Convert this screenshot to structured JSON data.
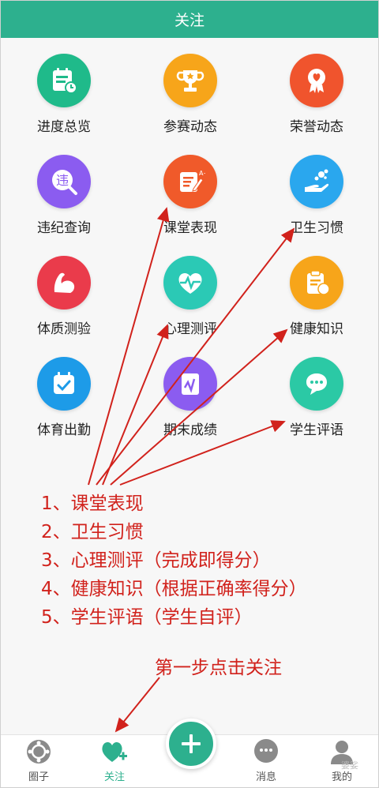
{
  "header": {
    "title": "关注"
  },
  "grid": [
    {
      "label": "进度总览",
      "icon": "calendar-clock-icon",
      "color": "#1fba8a"
    },
    {
      "label": "参赛动态",
      "icon": "trophy-icon",
      "color": "#f7a51a"
    },
    {
      "label": "荣誉动态",
      "icon": "medal-heart-icon",
      "color": "#f0542d"
    },
    {
      "label": "违纪查询",
      "icon": "violation-search-icon",
      "color": "#8b5cf0",
      "glyph": "违"
    },
    {
      "label": "课堂表现",
      "icon": "edit-grade-icon",
      "color": "#f05a2a"
    },
    {
      "label": "卫生习惯",
      "icon": "hand-wash-icon",
      "color": "#2aa7ee"
    },
    {
      "label": "体质测验",
      "icon": "arm-muscle-icon",
      "color": "#ea3b4b"
    },
    {
      "label": "心理测评",
      "icon": "heartbeat-icon",
      "color": "#2bc9b5"
    },
    {
      "label": "健康知识",
      "icon": "clipboard-apple-icon",
      "color": "#f7a51a"
    },
    {
      "label": "体育出勤",
      "icon": "calendar-check-icon",
      "color": "#1d9be8"
    },
    {
      "label": "期末成绩",
      "icon": "chart-report-icon",
      "color": "#8b5cf0"
    },
    {
      "label": "学生评语",
      "icon": "chat-bubble-icon",
      "color": "#2bc9a5"
    }
  ],
  "notes": [
    "1、课堂表现",
    "2、卫生习惯",
    "3、心理测评（完成即得分）",
    "4、健康知识（根据正确率得分）",
    "5、学生评语（学生自评）"
  ],
  "step_note": "第一步点击关注",
  "tabbar": {
    "tabs": [
      {
        "label": "圈子",
        "icon": "circle-group-icon"
      },
      {
        "label": "关注",
        "icon": "heart-plus-icon",
        "active": true
      },
      {
        "label": "消息",
        "icon": "message-icon"
      },
      {
        "label": "我的",
        "icon": "user-icon"
      }
    ],
    "fab_icon": "plus-icon"
  },
  "watermark": "婆娑"
}
